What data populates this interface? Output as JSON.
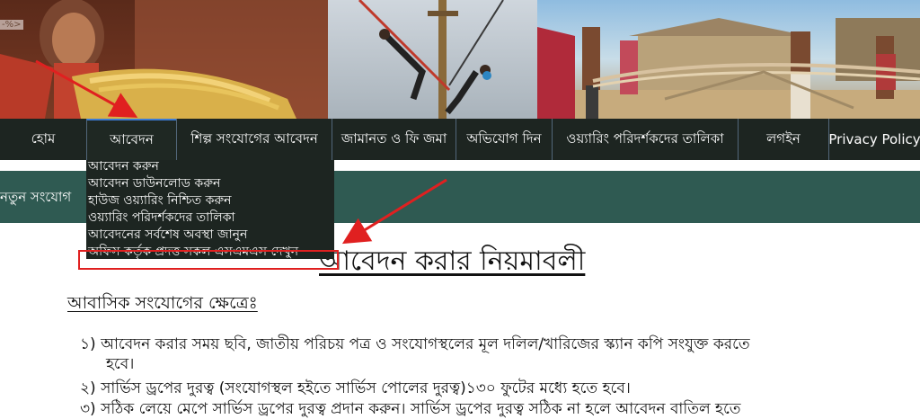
{
  "banner": {
    "corner_tag": "-%>"
  },
  "nav": {
    "items": [
      {
        "label": "হোম"
      },
      {
        "label": "আবেদন"
      },
      {
        "label": "শিল্প সংযোগের আবেদন"
      },
      {
        "label": "জামানত ও ফি জমা"
      },
      {
        "label": "অভিযোগ দিন"
      },
      {
        "label": "ওয়্যারিং পরিদর্শকদের তালিকা"
      },
      {
        "label": "লগইন"
      },
      {
        "label": "Privacy Policy"
      }
    ],
    "active_index": 1
  },
  "dropdown": {
    "items": [
      {
        "label": "আবেদন করুন"
      },
      {
        "label": "আবেদন ডাউনলোড করুন"
      },
      {
        "label": "হাউজ ওয়্যারিং নিশ্চিত করুন"
      },
      {
        "label": "ওয়্যারিং পরিদর্শকদের তালিকা"
      },
      {
        "label": "আবেদনের সর্বশেষ অবস্থা জানুন"
      },
      {
        "label": "অফিস কর্তৃক প্রদত্ত সকল এসএমএস দেখুন"
      }
    ]
  },
  "strip": {
    "text": "নতুন সংযোগ"
  },
  "content": {
    "main_heading": "আবেদন করার নিয়মাবলী",
    "section_heading": "আবাসিক সংযোগের ক্ষেত্রেঃ",
    "rules": [
      {
        "line1": "১) আবেদন করার সময় ছবি, জাতীয় পরিচয় পত্র ও সংযোগস্থলের মূল দলিল/খারিজের স্ক্যান কপি সংযুক্ত করতে",
        "line2": "হবে।"
      },
      {
        "line1": "২) সার্ভিস ড্রপের দুরত্ব (সংযোগস্থল হইতে সার্ভিস পোলের দুরত্ব)১৩০ ফুটের মধ্যে হতে হবে।"
      },
      {
        "line1": "৩) সঠিক লেয়ে মেপে সার্ভিস ড্রপের দুরত্ব প্রদান করুন। সার্ভিস ড্রপের দুরত্ব সঠিক না হলে আবেদন বাতিল হতে"
      }
    ]
  },
  "colors": {
    "nav_bg": "#1d2521",
    "nav_divider": "#52677a",
    "active_accent": "#3b7bd4",
    "strip_bg": "#2f5a52",
    "annotation_red": "#e02020"
  }
}
